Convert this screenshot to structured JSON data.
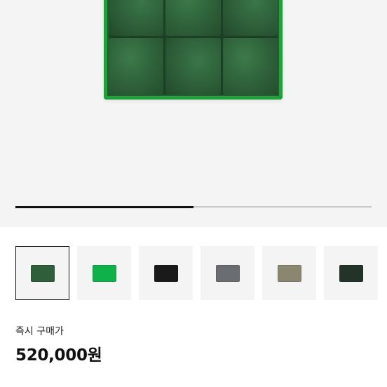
{
  "product": {
    "purchase_label": "즉시 구매가",
    "price": "520,000원",
    "main_color": "#2e6039"
  },
  "gallery": {
    "progress_fraction": 0.5
  },
  "variants": [
    {
      "color_name": "dark-green",
      "color": "#2f5e3a",
      "selected": true
    },
    {
      "color_name": "bright-green",
      "color": "#0fb24a",
      "selected": false
    },
    {
      "color_name": "black",
      "color": "#1a1a1a",
      "selected": false
    },
    {
      "color_name": "gray",
      "color": "#6a6d72",
      "selected": false
    },
    {
      "color_name": "taupe",
      "color": "#8a8670",
      "selected": false
    },
    {
      "color_name": "dark-forest",
      "color": "#243328",
      "selected": false
    }
  ]
}
